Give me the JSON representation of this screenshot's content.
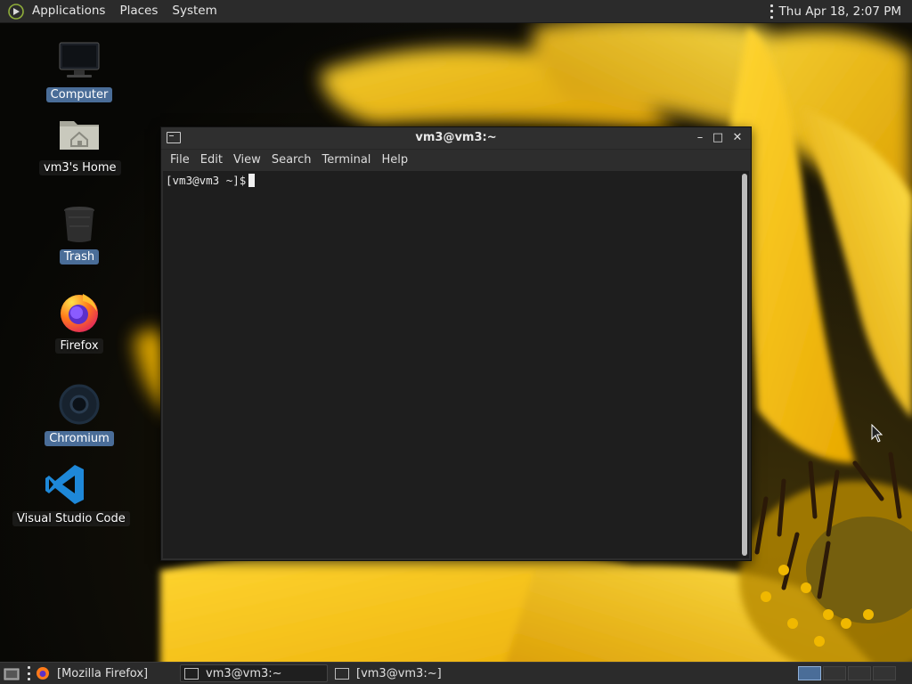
{
  "top_panel": {
    "menus": [
      "Applications",
      "Places",
      "System"
    ],
    "clock": "Thu Apr 18,  2:07 PM"
  },
  "desktop_icons": [
    {
      "label": "Computer",
      "icon": "computer-icon"
    },
    {
      "label": "vm3's Home",
      "icon": "home-folder-icon"
    },
    {
      "label": "Trash",
      "icon": "trash-icon"
    },
    {
      "label": "Firefox",
      "icon": "firefox-icon"
    },
    {
      "label": "Chromium",
      "icon": "chromium-icon"
    },
    {
      "label": "Visual Studio Code",
      "icon": "vscode-icon"
    }
  ],
  "terminal": {
    "title": "vm3@vm3:~",
    "menus": [
      "File",
      "Edit",
      "View",
      "Search",
      "Terminal",
      "Help"
    ],
    "prompt": "[vm3@vm3 ~]$",
    "controls": {
      "minimize": "–",
      "maximize": "□",
      "close": "✕"
    }
  },
  "taskbar": {
    "tasks": [
      {
        "label": "[Mozilla Firefox]",
        "icon": "firefox-icon",
        "active": false
      },
      {
        "label": "vm3@vm3:~",
        "icon": "terminal-icon",
        "active": true
      },
      {
        "label": "[vm3@vm3:~]",
        "icon": "terminal-icon",
        "active": false
      }
    ]
  },
  "colors": {
    "panel": "#2b2b2b",
    "selection": "#4a6d98",
    "terminal_bg": "#1e1e1e",
    "petal": "#f6c200"
  }
}
